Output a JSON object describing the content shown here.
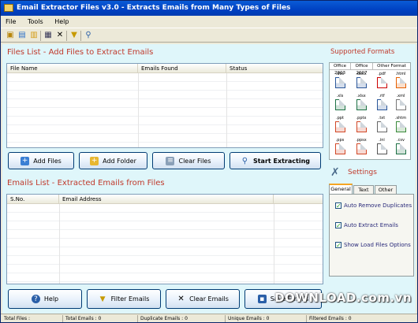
{
  "window": {
    "title": "Email Extractor Files v3.0 - Extracts Emails from Many Types of Files"
  },
  "menu": [
    "File",
    "Tools",
    "Help"
  ],
  "toolbar": {
    "icons": [
      "folder-open-icon",
      "add-files-icon",
      "add-folder-icon",
      "list-icon",
      "delete-icon",
      "filter-icon",
      "search-icon"
    ]
  },
  "files": {
    "section_title": "Files List - Add Files to Extract Emails",
    "columns": [
      "File Name",
      "Emails Found",
      "Status"
    ],
    "buttons": {
      "add_files": "Add Files",
      "add_folder": "Add Folder",
      "clear_files": "Clear Files",
      "start_extracting": "Start Extracting"
    }
  },
  "emails": {
    "section_title": "Emails List - Extracted Emails from Files",
    "columns": [
      "S.No.",
      "Email Address"
    ],
    "buttons": {
      "help": "Help",
      "filter_emails": "Filter Emails",
      "clear_emails": "Clear Emails",
      "save_emails": "Save Emails"
    }
  },
  "formats": {
    "title": "Supported Formats",
    "headers": [
      "Office 2003",
      "Office 2007",
      "Other Format"
    ],
    "items": [
      ".doc",
      ".docx",
      ".pdf",
      ".html",
      ".xls",
      ".xlsx",
      ".rtf",
      ".xml",
      ".ppt",
      ".pptx",
      ".txt",
      ".shtm",
      ".pps",
      ".ppsx",
      ".ini",
      ".csv"
    ]
  },
  "settings": {
    "title": "Settings",
    "tabs": [
      "General",
      "Text",
      "Other"
    ],
    "options": [
      {
        "label": "Auto Remove Duplicates",
        "checked": true
      },
      {
        "label": "Auto Extract Emails",
        "checked": true
      },
      {
        "label": "Show Load Files Options",
        "checked": true
      }
    ]
  },
  "status": {
    "total_files": "Total Files :",
    "total_emails": "Total Emails :  0",
    "duplicate_emails": "Duplicate Emails :  0",
    "unique_emails": "Unique Emails :  0",
    "filtered_emails": "Filtered Emails :  0"
  },
  "watermark": "DOWNLOAD.com.vn",
  "colors": {
    "section_title": "#c0392b",
    "client_bg": "#dff6fa",
    "titlebar": "#0a5bd6"
  }
}
